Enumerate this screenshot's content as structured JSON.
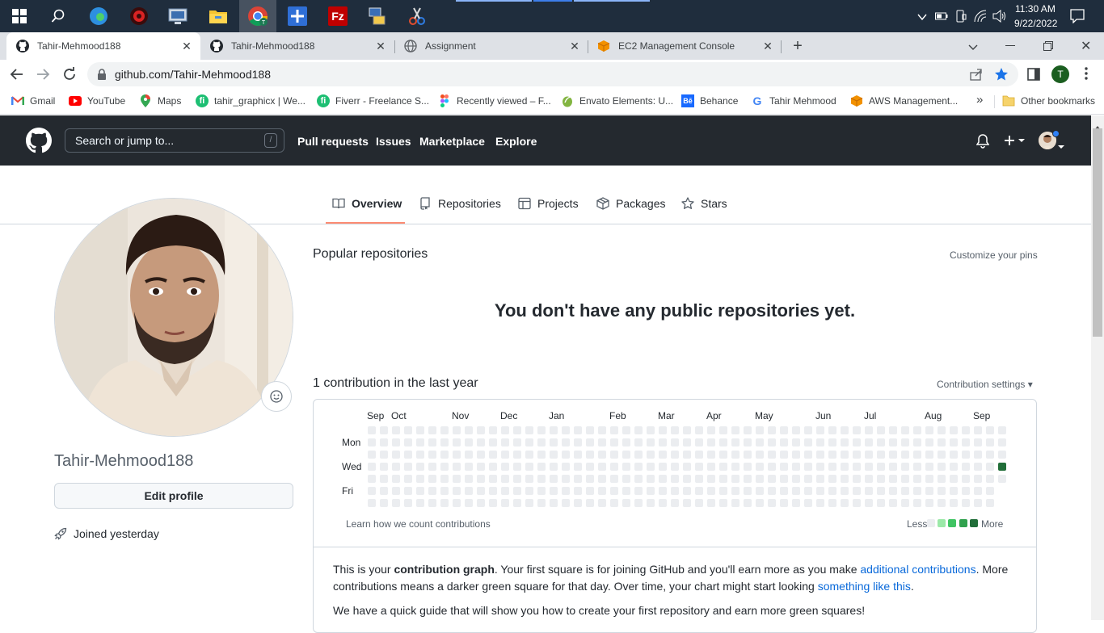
{
  "taskbar": {
    "icons": [
      "windows-start-icon",
      "search-icon",
      "edge-icon",
      "app-red-icon",
      "network-app-icon",
      "file-explorer-icon",
      "chrome-icon",
      "plus-app-icon",
      "filezilla-icon",
      "network-config-icon",
      "snipping-icon"
    ],
    "chrome_profile_letter": "T",
    "time": "11:30 AM",
    "date": "9/22/2022"
  },
  "browser": {
    "tabs": [
      {
        "title": "Tahir-Mehmood188",
        "active": true
      },
      {
        "title": "Tahir-Mehmood188",
        "active": false
      },
      {
        "title": "Assignment",
        "active": false
      },
      {
        "title": "EC2 Management Console",
        "active": false
      }
    ],
    "url": "github.com/Tahir-Mehmood188",
    "profile_letter": "T",
    "bookmarks": [
      {
        "label": "Gmail",
        "icon": "gmail-icon"
      },
      {
        "label": "YouTube",
        "icon": "youtube-icon"
      },
      {
        "label": "Maps",
        "icon": "maps-icon"
      },
      {
        "label": "tahir_graphicx | We...",
        "icon": "fiverr-icon"
      },
      {
        "label": "Fiverr - Freelance S...",
        "icon": "fiverr-icon"
      },
      {
        "label": "Recently viewed – F...",
        "icon": "figma-icon"
      },
      {
        "label": "Envato Elements: U...",
        "icon": "envato-icon"
      },
      {
        "label": "Behance",
        "icon": "behance-icon"
      },
      {
        "label": "Tahir Mehmood",
        "icon": "google-icon"
      },
      {
        "label": "AWS Management...",
        "icon": "aws-icon"
      }
    ],
    "bookmarks_more": "»",
    "other_bookmarks": "Other bookmarks"
  },
  "github": {
    "search_placeholder": "Search or jump to...",
    "search_key": "/",
    "nav": [
      "Pull requests",
      "Issues",
      "Marketplace",
      "Explore"
    ],
    "profile_tabs": [
      "Overview",
      "Repositories",
      "Projects",
      "Packages",
      "Stars"
    ],
    "username": "Tahir-Mehmood188",
    "edit_profile": "Edit profile",
    "joined": "Joined yesterday",
    "popular_repos": "Popular repositories",
    "customize_pins": "Customize your pins",
    "no_repos": "You don't have any public repositories yet.",
    "contrib_title": "1 contribution in the last year",
    "contrib_settings": "Contribution settings ▾",
    "months": [
      "Sep",
      "Oct",
      "Nov",
      "Dec",
      "Jan",
      "Feb",
      "Mar",
      "Apr",
      "May",
      "Jun",
      "Jul",
      "Aug",
      "Sep"
    ],
    "day_labels": [
      "Mon",
      "Wed",
      "Fri"
    ],
    "learn_link": "Learn how we count contributions",
    "legend_less": "Less",
    "legend_more": "More",
    "legend_colors": [
      "#ebedf0",
      "#9be9a8",
      "#40c463",
      "#30a14e",
      "#216e39"
    ],
    "contribution_week_count": 53,
    "contribution_last_week_days": 5,
    "contribution_active": {
      "week": 52,
      "day": 3,
      "color": "#216e39"
    },
    "info": {
      "p1_a": "This is your ",
      "p1_b": "contribution graph",
      "p1_c": ". Your first square is for joining GitHub and you'll earn more as you make ",
      "p1_link1": "additional contributions",
      "p1_d": ". More contributions means a darker green square for that day. Over time, your chart might start looking ",
      "p1_link2": "something like this",
      "p1_e": ".",
      "p2": "We have a quick guide that will show you how to create your first repository and earn more green squares!"
    }
  }
}
